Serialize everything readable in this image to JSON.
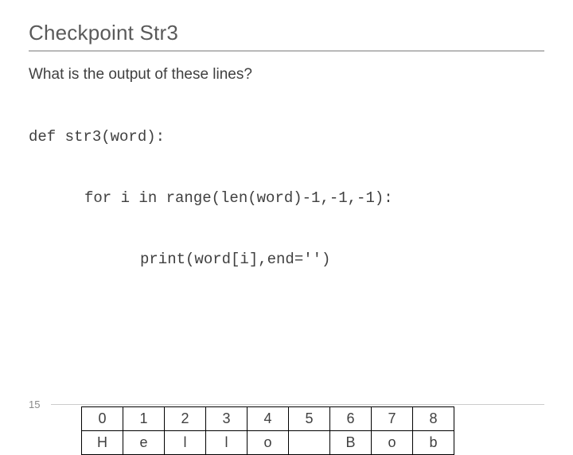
{
  "title": "Checkpoint Str3",
  "question": "What is the output of these lines?",
  "code": {
    "l1": "def str3(word):",
    "l2": "for i in range(len(word)-1,-1,-1):",
    "l3": "print(word[i],end='')"
  },
  "table": {
    "header": [
      "0",
      "1",
      "2",
      "3",
      "4",
      "5",
      "6",
      "7",
      "8"
    ],
    "row": [
      "H",
      "e",
      "l",
      "l",
      "o",
      "",
      "B",
      "o",
      "b"
    ]
  },
  "page": "15"
}
